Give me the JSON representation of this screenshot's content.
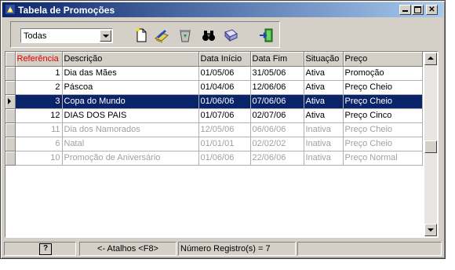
{
  "window": {
    "title": "Tabela de Promoções"
  },
  "filter": {
    "selected": "Todas"
  },
  "grid": {
    "columns": [
      "Referência",
      "Descrição",
      "Data Início",
      "Data Fim",
      "Situação",
      "Preço"
    ],
    "rows": [
      {
        "ref": "1",
        "desc": "Dia das Mães",
        "start": "01/05/06",
        "end": "31/05/06",
        "status": "Ativa",
        "price": "Promoção"
      },
      {
        "ref": "2",
        "desc": "Páscoa",
        "start": "01/04/06",
        "end": "12/06/06",
        "status": "Ativa",
        "price": "Preço Cheio"
      },
      {
        "ref": "3",
        "desc": "Copa do Mundo",
        "start": "01/06/06",
        "end": "07/06/06",
        "status": "Ativa",
        "price": "Preço Cheio"
      },
      {
        "ref": "12",
        "desc": "DIAS DOS PAIS",
        "start": "01/07/06",
        "end": "02/07/06",
        "status": "Ativa",
        "price": "Preço Cinco"
      },
      {
        "ref": "11",
        "desc": "Dia dos Namorados",
        "start": "12/05/06",
        "end": "06/06/06",
        "status": "Inativa",
        "price": "Preço Cheio"
      },
      {
        "ref": "6",
        "desc": "Natal",
        "start": "01/01/01",
        "end": "02/02/02",
        "status": "Inativa",
        "price": "Preço Cheio"
      },
      {
        "ref": "10",
        "desc": "Promoção de Aniversário",
        "start": "01/06/06",
        "end": "22/06/06",
        "status": "Inativa",
        "price": "Preço Normal"
      }
    ]
  },
  "status": {
    "help": "?",
    "shortcuts": "<- Atalhos <F8>",
    "count": "Número Registro(s) = 7"
  },
  "colors": {
    "title_start": "#0a246a",
    "title_end": "#a6caf0",
    "selection": "#0a246a",
    "header_ref": "#e00000",
    "inactive_text": "#a0a0a0"
  }
}
